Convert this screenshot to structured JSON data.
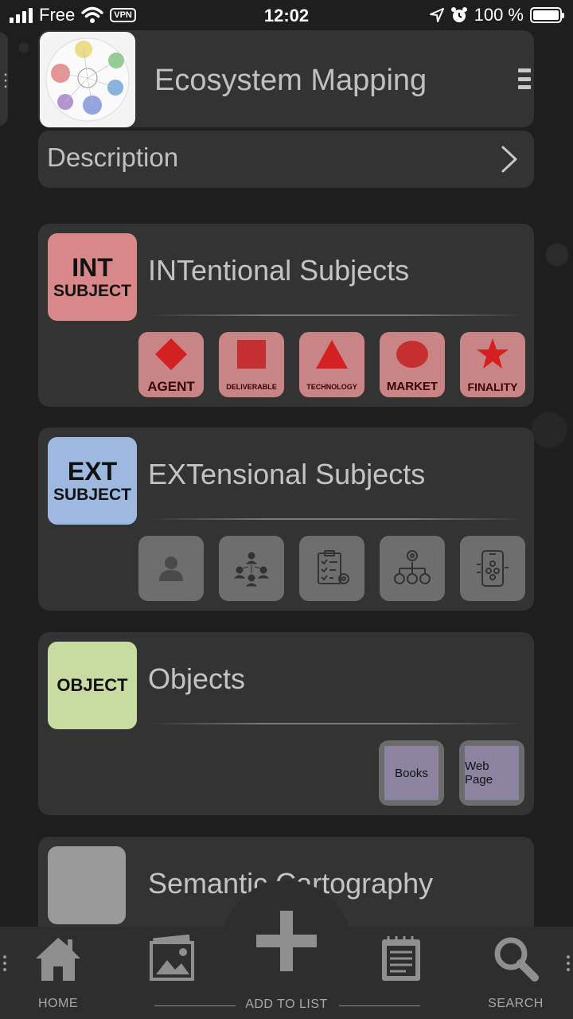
{
  "status_bar": {
    "carrier": "Free",
    "vpn": "VPN",
    "time": "12:02",
    "battery": "100 %"
  },
  "header": {
    "title": "Ecosystem Mapping"
  },
  "description": {
    "label": "Description"
  },
  "sections": [
    {
      "badge_line1": "INT",
      "badge_line2": "SUBJECT",
      "badge_color": "#d9888a",
      "title": "INTentional Subjects",
      "tiles": [
        "AGENT",
        "DELIVERABLE",
        "TECHNOLOGY",
        "MARKET",
        "FINALITY"
      ]
    },
    {
      "badge_line1": "EXT",
      "badge_line2": "SUBJECT",
      "badge_color": "#9db9e0",
      "title": "EXTensional Subjects",
      "tiles": [
        "person-icon",
        "organization-icon",
        "checklist-icon",
        "process-icon",
        "app-icon"
      ]
    },
    {
      "badge_line1": "OBJECT",
      "badge_color": "#c8dba0",
      "title": "Objects",
      "tiles": [
        "Books",
        "Web Page"
      ]
    },
    {
      "badge_color": "#9a9a9a",
      "title": "Semantic Cartography"
    }
  ],
  "bottom_nav": {
    "home": "HOME",
    "add": "ADD TO LIST",
    "search": "SEARCH"
  }
}
